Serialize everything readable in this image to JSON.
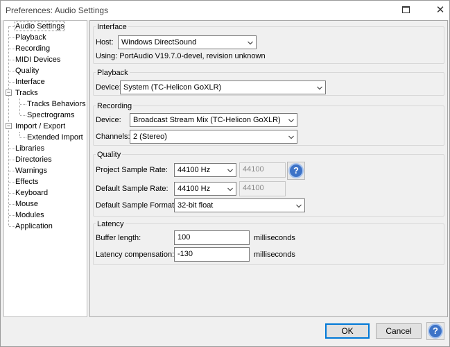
{
  "window": {
    "title": "Preferences: Audio Settings",
    "restore_label": "",
    "close_label": "✕"
  },
  "tree": {
    "items": [
      {
        "label": "Audio Settings"
      },
      {
        "label": "Playback"
      },
      {
        "label": "Recording"
      },
      {
        "label": "MIDI Devices"
      },
      {
        "label": "Quality"
      },
      {
        "label": "Interface"
      },
      {
        "label": "Tracks"
      },
      {
        "label": "Tracks Behaviors"
      },
      {
        "label": "Spectrograms"
      },
      {
        "label": "Import / Export"
      },
      {
        "label": "Extended Import"
      },
      {
        "label": "Libraries"
      },
      {
        "label": "Directories"
      },
      {
        "label": "Warnings"
      },
      {
        "label": "Effects"
      },
      {
        "label": "Keyboard"
      },
      {
        "label": "Mouse"
      },
      {
        "label": "Modules"
      },
      {
        "label": "Application"
      }
    ],
    "expander_minus": "−"
  },
  "interface": {
    "title": "Interface",
    "host_label": "Host:",
    "host_value": "Windows DirectSound",
    "using_text": "Using: PortAudio V19.7.0-devel, revision unknown"
  },
  "playback": {
    "title": "Playback",
    "device_label": "Device:",
    "device_value": "System (TC-Helicon GoXLR)"
  },
  "recording": {
    "title": "Recording",
    "device_label": "Device:",
    "device_value": "Broadcast Stream Mix (TC-Helicon GoXLR)",
    "channels_label": "Channels:",
    "channels_value": "2 (Stereo)"
  },
  "quality": {
    "title": "Quality",
    "project_rate_label": "Project Sample Rate:",
    "project_rate_value": "44100 Hz",
    "project_rate_text": "44100",
    "default_rate_label": "Default Sample Rate:",
    "default_rate_value": "44100 Hz",
    "default_rate_text": "44100",
    "format_label": "Default Sample Format:",
    "format_value": "32-bit float",
    "help": "?"
  },
  "latency": {
    "title": "Latency",
    "buffer_label": "Buffer length:",
    "buffer_value": "100",
    "buffer_unit": "milliseconds",
    "compensation_label": "Latency compensation:",
    "compensation_value": "-130",
    "compensation_unit": "milliseconds"
  },
  "footer": {
    "ok_label": "OK",
    "cancel_label": "Cancel",
    "help": "?"
  },
  "colors": {
    "accent": "#0078d7",
    "help_blue": "#3d73c7"
  }
}
